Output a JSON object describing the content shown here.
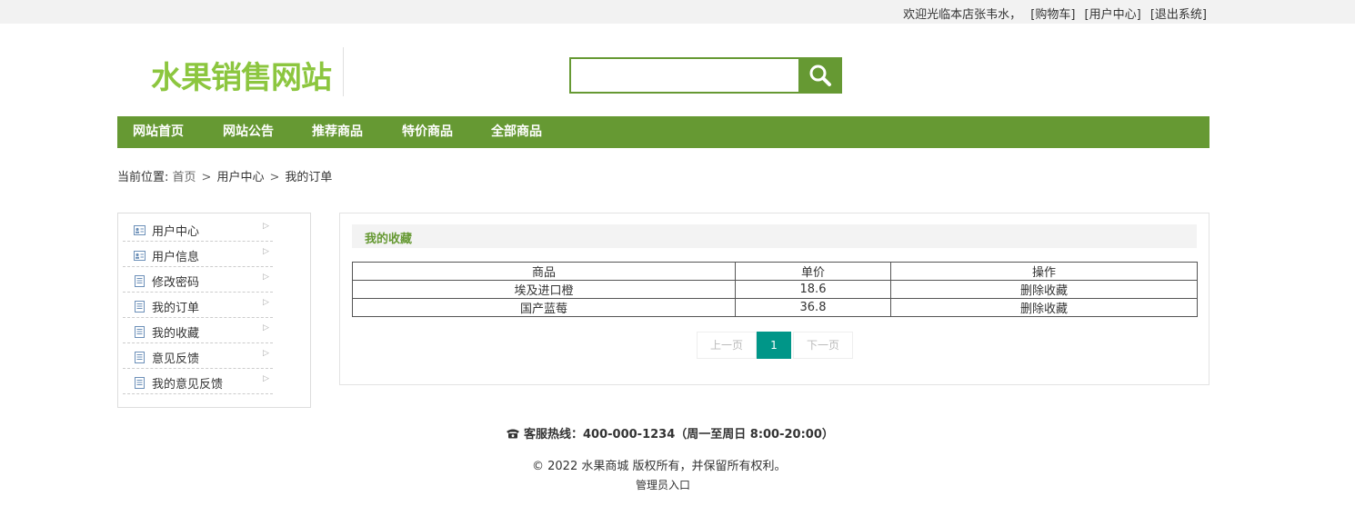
{
  "topbar": {
    "welcome": "欢迎光临本店张韦水，",
    "cart": "[购物车]",
    "user_center": "[用户中心]",
    "logout": "[退出系统]"
  },
  "header": {
    "logo": "水果销售网站",
    "search": {
      "value": "",
      "placeholder": ""
    }
  },
  "nav": {
    "items": [
      {
        "label": "网站首页"
      },
      {
        "label": "网站公告"
      },
      {
        "label": "推荐商品"
      },
      {
        "label": "特价商品"
      },
      {
        "label": "全部商品"
      }
    ]
  },
  "breadcrumb": {
    "prefix": "当前位置:",
    "items": [
      "首页",
      "用户中心",
      "我的订单"
    ],
    "separator": ">"
  },
  "sidebar": {
    "items": [
      {
        "label": "用户中心",
        "icon": "user-card-icon"
      },
      {
        "label": "用户信息",
        "icon": "user-card-icon"
      },
      {
        "label": "修改密码",
        "icon": "document-icon"
      },
      {
        "label": "我的订单",
        "icon": "document-icon"
      },
      {
        "label": "我的收藏",
        "icon": "document-icon"
      },
      {
        "label": "意见反馈",
        "icon": "document-icon"
      },
      {
        "label": "我的意见反馈",
        "icon": "document-icon"
      }
    ]
  },
  "panel": {
    "title": "我的收藏",
    "columns": [
      "商品",
      "单价",
      "操作"
    ],
    "rows": [
      {
        "name": "埃及进口橙",
        "price": "18.6",
        "action": "删除收藏"
      },
      {
        "name": "国产蓝莓",
        "price": "36.8",
        "action": "删除收藏"
      }
    ],
    "pager": {
      "prev": "上一页",
      "current": "1",
      "next": "下一页"
    }
  },
  "footer": {
    "hotline": "客服热线：400-000-1234（周一至周日 8:00-20:00）",
    "copyright": "© 2022 水果商城 版权所有，并保留所有权利。",
    "admin": "管理员入口"
  },
  "colors": {
    "brand_green": "#669933",
    "logo_green": "#8cc63f",
    "pager_active": "#009688"
  }
}
